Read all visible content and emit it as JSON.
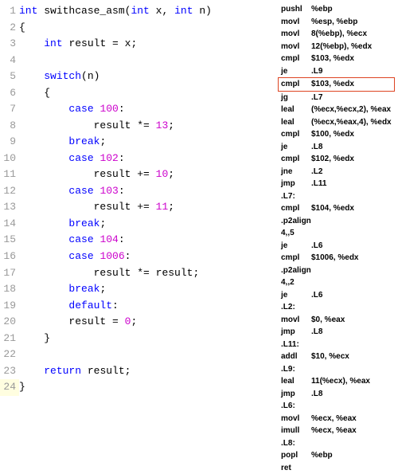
{
  "c_code": {
    "lines": [
      {
        "n": "1",
        "tokens": [
          "kw:int",
          " ",
          "ident:swithcase_asm",
          "paren:(",
          "kw:int",
          " ",
          "ident:x",
          "op:, ",
          "kw:int",
          " ",
          "ident:n",
          "paren:)"
        ]
      },
      {
        "n": "2",
        "tokens": [
          "ident:{"
        ]
      },
      {
        "n": "3",
        "tokens": [
          "    ",
          "kw:int",
          " ",
          "ident:result ",
          "op:= ",
          "ident:x",
          "op:;"
        ]
      },
      {
        "n": "4",
        "tokens": []
      },
      {
        "n": "5",
        "tokens": [
          "    ",
          "kw:switch",
          "paren:(",
          "ident:n",
          "paren:)"
        ]
      },
      {
        "n": "6",
        "tokens": [
          "    ",
          "ident:{"
        ]
      },
      {
        "n": "7",
        "tokens": [
          "        ",
          "kw:case",
          " ",
          "num:100",
          "op::"
        ]
      },
      {
        "n": "8",
        "tokens": [
          "            ",
          "ident:result ",
          "op:*= ",
          "num:13",
          "op:;"
        ]
      },
      {
        "n": "9",
        "tokens": [
          "        ",
          "kw:break",
          "op:;"
        ]
      },
      {
        "n": "10",
        "tokens": [
          "        ",
          "kw:case",
          " ",
          "num:102",
          "op::"
        ]
      },
      {
        "n": "11",
        "tokens": [
          "            ",
          "ident:result ",
          "op:+= ",
          "num:10",
          "op:;"
        ]
      },
      {
        "n": "12",
        "tokens": [
          "        ",
          "kw:case",
          " ",
          "num:103",
          "op::"
        ]
      },
      {
        "n": "13",
        "tokens": [
          "            ",
          "ident:result ",
          "op:+= ",
          "num:11",
          "op:;"
        ]
      },
      {
        "n": "14",
        "tokens": [
          "        ",
          "kw:break",
          "op:;"
        ]
      },
      {
        "n": "15",
        "tokens": [
          "        ",
          "kw:case",
          " ",
          "num:104",
          "op::"
        ]
      },
      {
        "n": "16",
        "tokens": [
          "        ",
          "kw:case",
          " ",
          "num:1006",
          "op::"
        ]
      },
      {
        "n": "17",
        "tokens": [
          "            ",
          "ident:result ",
          "op:*= ",
          "ident:result",
          "op:;"
        ]
      },
      {
        "n": "18",
        "tokens": [
          "        ",
          "kw:break",
          "op:;"
        ]
      },
      {
        "n": "19",
        "tokens": [
          "        ",
          "kw:default",
          "op::"
        ]
      },
      {
        "n": "20",
        "tokens": [
          "        ",
          "ident:result ",
          "op:= ",
          "num:0",
          "op:;"
        ]
      },
      {
        "n": "21",
        "tokens": [
          "    ",
          "ident:}"
        ]
      },
      {
        "n": "22",
        "tokens": []
      },
      {
        "n": "23",
        "tokens": [
          "    ",
          "kw:return",
          " ",
          "ident:result",
          "op:;"
        ]
      },
      {
        "n": "24",
        "active": true,
        "tokens": [
          "ident:}"
        ]
      }
    ]
  },
  "asm": {
    "lines": [
      {
        "mn": "pushl",
        "op": "%ebp"
      },
      {
        "mn": "movl",
        "op": "%esp, %ebp"
      },
      {
        "mn": "movl",
        "op": "8(%ebp), %ecx"
      },
      {
        "mn": "movl",
        "op": "12(%ebp), %edx"
      },
      {
        "mn": "cmpl",
        "op": "$103, %edx"
      },
      {
        "mn": "je",
        "op": ".L9"
      },
      {
        "mn": "cmpl",
        "op": "$103, %edx",
        "hl": true
      },
      {
        "mn": "jg",
        "op": ".L7"
      },
      {
        "mn": "leal",
        "op": "(%ecx,%ecx,2), %eax"
      },
      {
        "mn": "leal",
        "op": "(%ecx,%eax,4), %edx"
      },
      {
        "mn": "cmpl",
        "op": "$100, %edx"
      },
      {
        "mn": "je",
        "op": ".L8"
      },
      {
        "mn": "cmpl",
        "op": "$102, %edx"
      },
      {
        "mn": "jne",
        "op": ".L2"
      },
      {
        "mn": "jmp",
        "op": ".L11"
      },
      {
        "label": ".L7:"
      },
      {
        "mn": "cmpl",
        "op": "$104, %edx"
      },
      {
        "mn": ".p2align 4,,5",
        "op": ""
      },
      {
        "mn": "je",
        "op": ".L6"
      },
      {
        "mn": "cmpl",
        "op": "$1006, %edx"
      },
      {
        "mn": ".p2align 4,,2",
        "op": ""
      },
      {
        "mn": "je",
        "op": ".L6"
      },
      {
        "label": ".L2:"
      },
      {
        "mn": "movl",
        "op": "$0, %eax"
      },
      {
        "mn": "jmp",
        "op": ".L8"
      },
      {
        "label": ".L11:"
      },
      {
        "mn": "addl",
        "op": "$10, %ecx"
      },
      {
        "label": ".L9:"
      },
      {
        "mn": "leal",
        "op": "11(%ecx), %eax"
      },
      {
        "mn": "jmp",
        "op": ".L8"
      },
      {
        "label": ".L6:"
      },
      {
        "mn": "movl",
        "op": "%ecx, %eax"
      },
      {
        "mn": "imull",
        "op": "%ecx, %eax"
      },
      {
        "label": ".L8:"
      },
      {
        "mn": "popl",
        "op": "%ebp"
      },
      {
        "mn": "ret",
        "op": ""
      }
    ]
  }
}
